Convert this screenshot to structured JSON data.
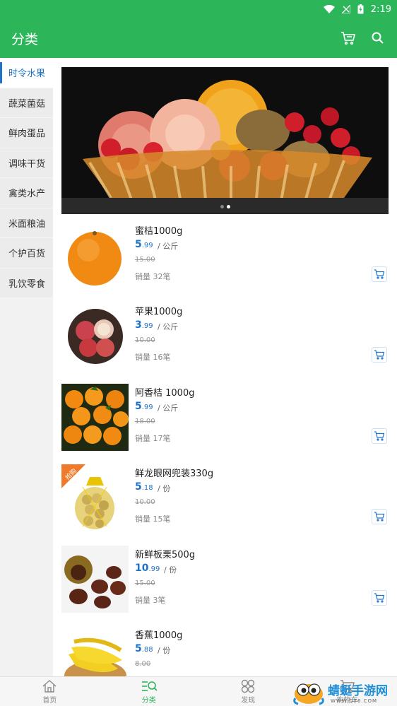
{
  "status_bar": {
    "time": "2:19"
  },
  "app_bar": {
    "title": "分类",
    "cart_icon": "cart-icon",
    "search_icon": "search-icon"
  },
  "colors": {
    "brand": "#2db55a",
    "accent": "#1f73c9"
  },
  "categories": [
    {
      "label": "时令水果",
      "active": true
    },
    {
      "label": "蔬菜菌菇",
      "active": false
    },
    {
      "label": "鲜肉蛋品",
      "active": false
    },
    {
      "label": "调味干货",
      "active": false
    },
    {
      "label": "禽类水产",
      "active": false
    },
    {
      "label": "米面粮油",
      "active": false
    },
    {
      "label": "个护百货",
      "active": false
    },
    {
      "label": "乳饮零食",
      "active": false
    }
  ],
  "banner": {
    "slides": 2,
    "active_slide": 2
  },
  "products": [
    {
      "name": "蜜桔1000g",
      "price_int": "5",
      "price_dec": ".99",
      "unit": "/ 公斤",
      "old_price": "15.00",
      "sales": "销量 32笔"
    },
    {
      "name": "苹果1000g",
      "price_int": "3",
      "price_dec": ".99",
      "unit": "/ 公斤",
      "old_price": "10.00",
      "sales": "销量 16笔"
    },
    {
      "name": "阿香桔 1000g",
      "price_int": "5",
      "price_dec": ".99",
      "unit": "/ 公斤",
      "old_price": "18.00",
      "sales": "销量 17笔"
    },
    {
      "name": "鲜龙眼网兜装330g",
      "price_int": "5",
      "price_dec": ".18",
      "unit": "/ 份",
      "old_price": "10.00",
      "sales": "销量 15笔",
      "badge": "抢购"
    },
    {
      "name": "新鲜板栗500g",
      "price_int": "10",
      "price_dec": ".99",
      "unit": "/ 份",
      "old_price": "15.00",
      "sales": "销量 3笔"
    },
    {
      "name": "香蕉1000g",
      "price_int": "5",
      "price_dec": ".88",
      "unit": "/ 份",
      "old_price": "8.00",
      "sales": ""
    }
  ],
  "tab_bar": [
    {
      "label": "首页",
      "icon": "home-icon",
      "active": false
    },
    {
      "label": "分类",
      "icon": "category-icon",
      "active": true
    },
    {
      "label": "发现",
      "icon": "discover-icon",
      "active": false
    },
    {
      "label": "购物车",
      "icon": "cart-icon",
      "active": false
    }
  ],
  "watermark": {
    "text": "蜻蜓手游网",
    "url": "WWW.QT6.COM"
  }
}
